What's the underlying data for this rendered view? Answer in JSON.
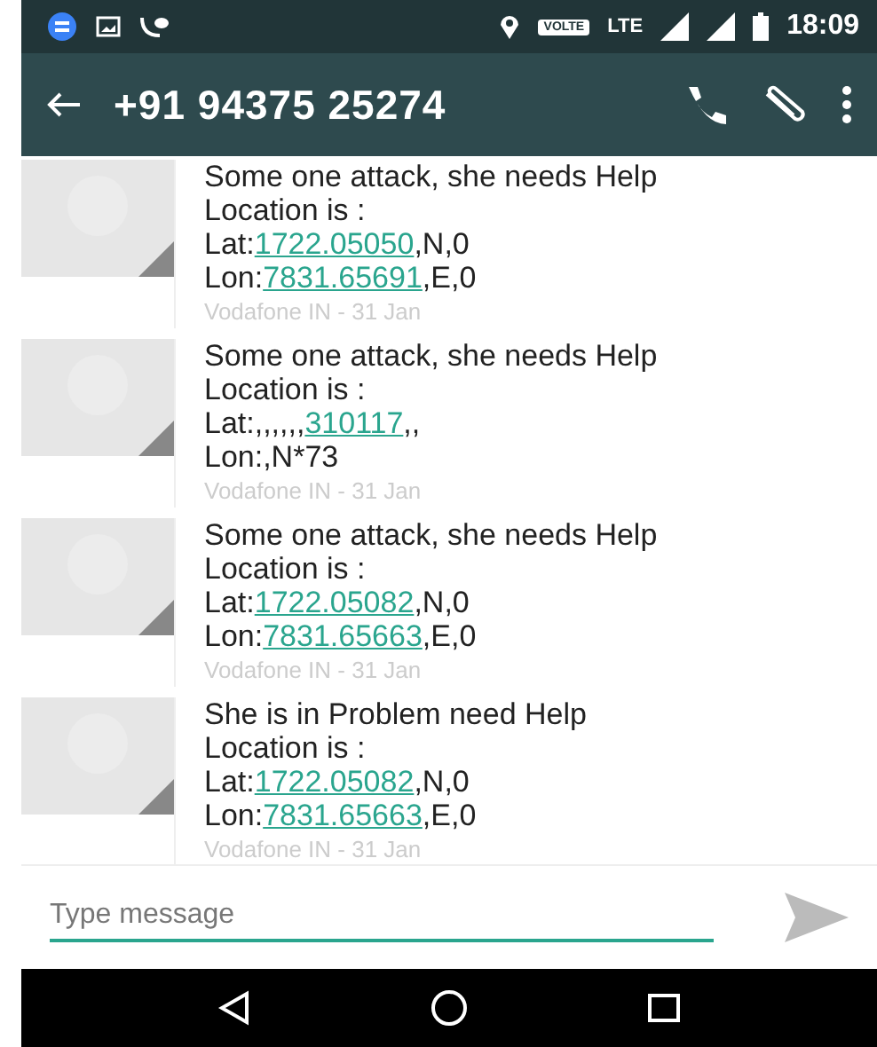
{
  "status_bar": {
    "time": "18:09",
    "volte": "VOLTE",
    "network": "LTE"
  },
  "toolbar": {
    "title": "+91 94375 25274"
  },
  "messages": [
    {
      "text": "Some one attack, she needs Help",
      "lines": [
        {
          "text": "Location is :"
        },
        {
          "prefix": "Lat:",
          "link": "1722.05050",
          "suffix": ",N,0"
        },
        {
          "prefix": "Lon:",
          "link": "7831.65691",
          "suffix": ",E,0"
        }
      ],
      "footer": "Vodafone IN - 31 Jan"
    },
    {
      "text": "Some one attack, she needs Help",
      "lines": [
        {
          "text": "Location is :"
        },
        {
          "prefix": "Lat:,,,,,,",
          "link": "310117",
          "suffix": ",,"
        },
        {
          "text": "Lon:,N*73"
        }
      ],
      "footer": "Vodafone IN - 31 Jan"
    },
    {
      "text": "Some one attack, she needs Help",
      "lines": [
        {
          "text": "Location is :"
        },
        {
          "prefix": "Lat:",
          "link": "1722.05082",
          "suffix": ",N,0"
        },
        {
          "prefix": "Lon:",
          "link": "7831.65663",
          "suffix": ",E,0"
        }
      ],
      "footer": "Vodafone IN - 31 Jan"
    },
    {
      "text": "She is in Problem need Help",
      "lines": [
        {
          "text": "Location is :"
        },
        {
          "prefix": "Lat:",
          "link": "1722.05082",
          "suffix": ",N,0"
        },
        {
          "prefix": "Lon:",
          "link": "7831.65663",
          "suffix": ",E,0"
        }
      ],
      "footer": "Vodafone IN - 31 Jan"
    }
  ],
  "composer": {
    "placeholder": "Type message"
  }
}
